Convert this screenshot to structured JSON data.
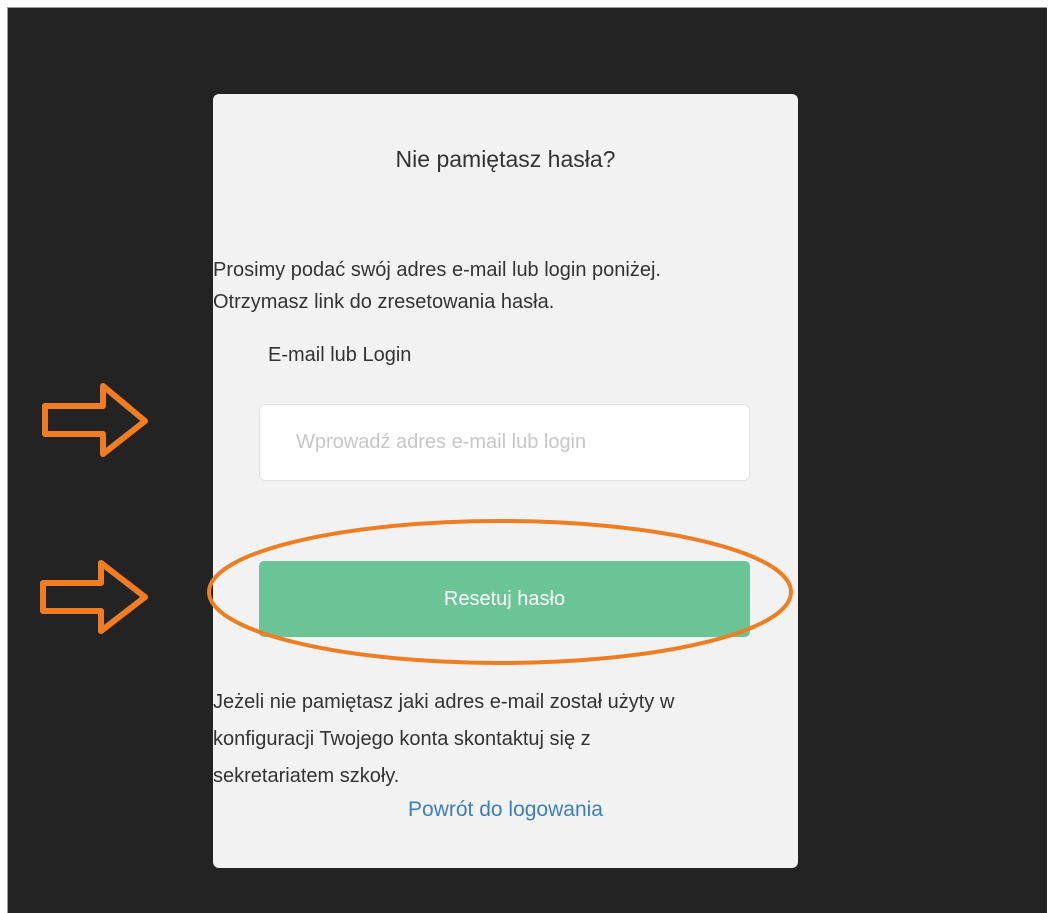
{
  "form": {
    "title": "Nie pamiętasz hasła?",
    "description_line1": "Prosimy podać swój adres e-mail lub login poniżej.",
    "description_line2": "Otrzymasz link do zresetowania hasła.",
    "field_label": "E-mail lub Login",
    "input_value": "",
    "input_placeholder": "Wprowadź adres e-mail lub login",
    "submit_label": "Resetuj hasło",
    "note_line1": "Jeżeli nie pamiętasz jaki adres e-mail został użyty w",
    "note_line2": "konfiguracji Twojego konta skontaktuj się z",
    "note_line3": "sekretariatem szkoły.",
    "back_link_label": "Powrót do logowania"
  },
  "annotations": {
    "color": "#f07d22",
    "arrow_icon": "right-arrow-outline",
    "highlight_shape": "ellipse-around-submit-button"
  },
  "colors": {
    "page_background": "#232323",
    "card_background": "#f2f2f2",
    "button_background": "#6bc495",
    "link_color": "#3f7fb8"
  }
}
